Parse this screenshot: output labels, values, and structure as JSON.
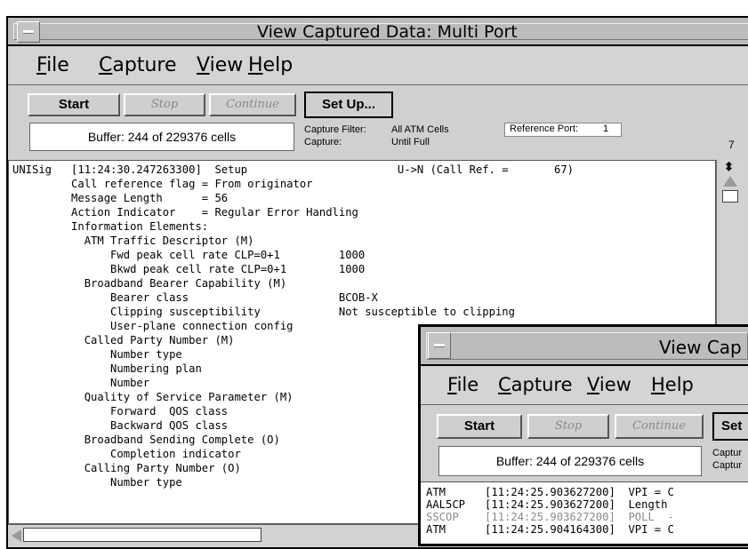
{
  "main_window": {
    "title": "View Captured Data: Multi Port",
    "menu": [
      {
        "label": "File",
        "mnemonic": "F",
        "rest": "ile"
      },
      {
        "label": "Capture",
        "mnemonic": "C",
        "rest": "apture"
      },
      {
        "label": "View",
        "mnemonic": "V",
        "rest": "iew"
      },
      {
        "label": "Help",
        "mnemonic": "H",
        "rest": "elp"
      }
    ],
    "buttons": {
      "start": "Start",
      "stop": "Stop",
      "continue": "Continue",
      "setup": "Set Up..."
    },
    "buffer_status": "Buffer: 244 of 229376 cells",
    "capture_filter_label": "Capture Filter:",
    "capture_filter_value": "All ATM Cells",
    "capture_label": "Capture:",
    "capture_value": "Until Full",
    "reference_port_label": "Reference Port:",
    "reference_port_value": "1",
    "counter": "7",
    "lines": [
      "UNISig   [11:24:30.247263300]  Setup                       U->N (Call Ref. =       67)",
      "         Call reference flag = From originator",
      "         Message Length      = 56",
      "         Action Indicator    = Regular Error Handling",
      "         Information Elements:",
      "           ATM Traffic Descriptor (M)",
      "               Fwd peak cell rate CLP=0+1         1000",
      "               Bkwd peak cell rate CLP=0+1        1000",
      "           Broadband Bearer Capability (M)",
      "               Bearer class                       BCOB-X",
      "               Clipping susceptibility            Not susceptible to clipping",
      "               User-plane connection config",
      "           Called Party Number (M)",
      "               Number type",
      "               Numbering plan",
      "               Number",
      "           Quality of Service Parameter (M)",
      "               Forward  QOS class",
      "               Backward QOS class",
      "           Broadband Sending Complete (O)",
      "               Completion indicator",
      "           Calling Party Number (O)",
      "               Number type"
    ]
  },
  "second_window": {
    "title": "View Cap",
    "menu": [
      {
        "label": "File",
        "mnemonic": "F",
        "rest": "ile"
      },
      {
        "label": "Capture",
        "mnemonic": "C",
        "rest": "apture"
      },
      {
        "label": "View",
        "mnemonic": "V",
        "rest": "iew"
      },
      {
        "label": "Help",
        "mnemonic": "H",
        "rest": "elp"
      }
    ],
    "buttons": {
      "start": "Start",
      "stop": "Stop",
      "continue": "Continue",
      "setup": "Set"
    },
    "buffer_status": "Buffer: 244 of 229376 cells",
    "capture_label_1": "Captur",
    "capture_label_2": "Captur",
    "lines": [
      {
        "text": "ATM      [11:24:25.903627200]  VPI = C",
        "gray": false
      },
      {
        "text": "AAL5CP   [11:24:25.903627200]  Length",
        "gray": false
      },
      {
        "text": "SSCOP    [11:24:25.903627200]  POLL  -",
        "gray": true
      },
      {
        "text": "ATM      [11:24:25.904164300]  VPI = C",
        "gray": false
      }
    ]
  }
}
